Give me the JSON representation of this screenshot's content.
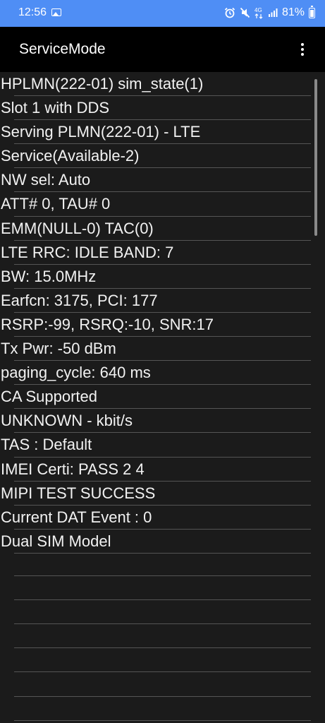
{
  "status_bar": {
    "time": "12:56",
    "battery": "81%",
    "network_type": "4G"
  },
  "app_bar": {
    "title": "ServiceMode"
  },
  "lines": [
    "HPLMN(222-01)  sim_state(1)",
    "Slot 1 with DDS",
    "Serving PLMN(222-01) - LTE",
    "Service(Available-2)",
    "NW sel: Auto",
    "ATT# 0, TAU# 0",
    "EMM(NULL-0) TAC(0)",
    "LTE RRC: IDLE BAND: 7",
    "BW: 15.0MHz",
    "Earfcn: 3175, PCI: 177",
    "RSRP:-99, RSRQ:-10, SNR:17",
    "Tx Pwr: -50 dBm",
    "paging_cycle: 640 ms",
    "CA Supported",
    "UNKNOWN - kbit/s",
    "TAS : Default",
    "IMEI Certi: PASS 2 4",
    "MIPI TEST SUCCESS",
    "Current DAT Event : 0",
    "Dual SIM Model"
  ],
  "colors": {
    "status_bar": "#4f8ef5",
    "app_bar": "#000000",
    "background": "#1b1b1b",
    "text": "#f2f2f2"
  }
}
